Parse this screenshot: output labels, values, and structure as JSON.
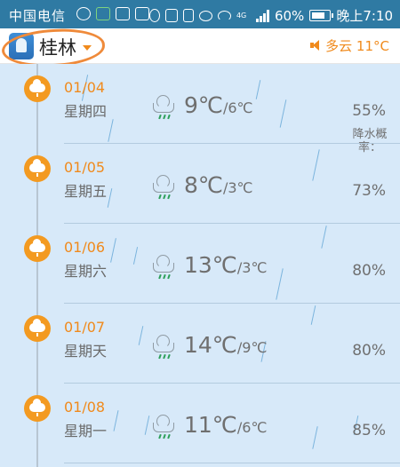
{
  "status_bar": {
    "carrier": "中国电信",
    "network": "4G",
    "battery": "60%",
    "time": "晚上7:10"
  },
  "header": {
    "city": "桂林",
    "current_weather": "多云 11°C",
    "colors": {
      "accent": "#f08a1c",
      "status_bar": "#2f7aa3",
      "list_bg": "#d7e9f9"
    }
  },
  "list": {
    "rain_title": "降水概率：",
    "days": [
      {
        "date": "01/04",
        "weekday": "星期四",
        "high": "9℃",
        "low": "/6℃",
        "rain": "55%",
        "icon": "rain-cloud-icon"
      },
      {
        "date": "01/05",
        "weekday": "星期五",
        "high": "8℃",
        "low": "/3℃",
        "rain": "73%",
        "icon": "rain-cloud-icon"
      },
      {
        "date": "01/06",
        "weekday": "星期六",
        "high": "13℃",
        "low": "/3℃",
        "rain": "80%",
        "icon": "rain-cloud-icon"
      },
      {
        "date": "01/07",
        "weekday": "星期天",
        "high": "14℃",
        "low": "/9℃",
        "rain": "80%",
        "icon": "rain-cloud-icon"
      },
      {
        "date": "01/08",
        "weekday": "星期一",
        "high": "11℃",
        "low": "/6℃",
        "rain": "85%",
        "icon": "rain-cloud-icon"
      }
    ]
  }
}
